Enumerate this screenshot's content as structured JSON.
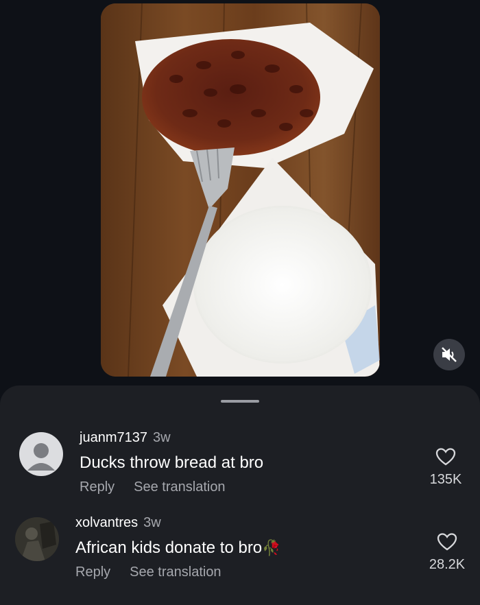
{
  "video": {
    "mute_icon": "speaker-muted-icon"
  },
  "comments": [
    {
      "username": "juanm7137",
      "time": "3w",
      "text": "Ducks throw bread at bro",
      "reply_label": "Reply",
      "translate_label": "See translation",
      "like_count": "135K",
      "avatar_icon": "default-avatar-icon"
    },
    {
      "username": "xolvantres",
      "time": "3w",
      "text": "African kids donate to bro",
      "emoji": "🥀",
      "reply_label": "Reply",
      "translate_label": "See translation",
      "like_count": "28.2K",
      "avatar_icon": "photo-avatar-icon"
    }
  ],
  "colors": {
    "background": "#0e1117",
    "sheet": "#1d1f24",
    "secondary_text": "#a6a8ae"
  }
}
